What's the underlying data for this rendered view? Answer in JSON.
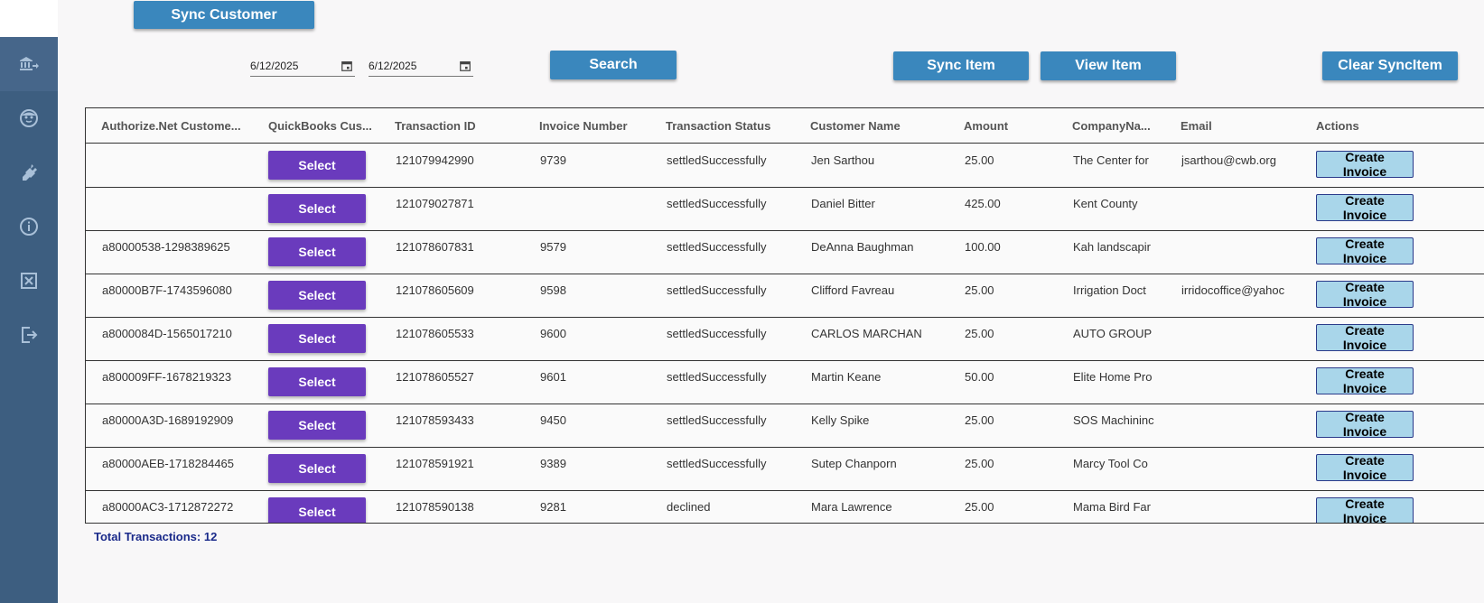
{
  "toolbar": {
    "sync_customer_label": "Sync Customer",
    "search_label": "Search",
    "sync_item_label": "Sync Item",
    "view_item_label": "View Item",
    "clear_sync_item_label": "Clear SyncItem",
    "start_date": "6/12/2025",
    "end_date": "6/12/2025"
  },
  "sidebar": {
    "icons": [
      "bank-transfer-icon",
      "customer-icon",
      "plug-icon",
      "info-icon",
      "close-box-icon",
      "logout-icon"
    ]
  },
  "table": {
    "headers": [
      "Authorize.Net Custome...",
      "QuickBooks Cus...",
      "Transaction ID",
      "Invoice Number",
      "Transaction Status",
      "Customer Name",
      "Amount",
      "CompanyNa...",
      "Email",
      "Actions"
    ],
    "select_label": "Select",
    "create_invoice_label": "Create Invoice",
    "rows": [
      {
        "auth_id": "",
        "txn_id": "121079942990",
        "invoice": "9739",
        "status": "settledSuccessfully",
        "customer": "Jen Sarthou",
        "amount": "25.00",
        "company": "The Center for",
        "email": "jsarthou@cwb.org"
      },
      {
        "auth_id": "",
        "txn_id": "121079027871",
        "invoice": "",
        "status": "settledSuccessfully",
        "customer": "Daniel Bitter",
        "amount": "425.00",
        "company": "Kent County",
        "email": ""
      },
      {
        "auth_id": "a80000538-1298389625",
        "txn_id": "121078607831",
        "invoice": "9579",
        "status": "settledSuccessfully",
        "customer": "DeAnna Baughman",
        "amount": "100.00",
        "company": "Kah landscapir",
        "email": ""
      },
      {
        "auth_id": "a80000B7F-1743596080",
        "txn_id": "121078605609",
        "invoice": "9598",
        "status": "settledSuccessfully",
        "customer": "Clifford Favreau",
        "amount": "25.00",
        "company": "Irrigation Doct",
        "email": "irridocoffice@yahoc"
      },
      {
        "auth_id": "a8000084D-1565017210",
        "txn_id": "121078605533",
        "invoice": "9600",
        "status": "settledSuccessfully",
        "customer": "CARLOS MARCHAN",
        "amount": "25.00",
        "company": "AUTO GROUP",
        "email": ""
      },
      {
        "auth_id": "a800009FF-1678219323",
        "txn_id": "121078605527",
        "invoice": "9601",
        "status": "settledSuccessfully",
        "customer": "Martin Keane",
        "amount": "50.00",
        "company": "Elite Home Pro",
        "email": ""
      },
      {
        "auth_id": "a80000A3D-1689192909",
        "txn_id": "121078593433",
        "invoice": "9450",
        "status": "settledSuccessfully",
        "customer": "Kelly Spike",
        "amount": "25.00",
        "company": "SOS Machininc",
        "email": ""
      },
      {
        "auth_id": "a80000AEB-1718284465",
        "txn_id": "121078591921",
        "invoice": "9389",
        "status": "settledSuccessfully",
        "customer": "Sutep Chanporn",
        "amount": "25.00",
        "company": "Marcy Tool Co",
        "email": ""
      },
      {
        "auth_id": "a80000AC3-1712872272",
        "txn_id": "121078590138",
        "invoice": "9281",
        "status": "declined",
        "customer": "Mara Lawrence",
        "amount": "25.00",
        "company": "Mama Bird Far",
        "email": ""
      }
    ]
  },
  "footer": {
    "total_label": "Total Transactions: 12"
  }
}
